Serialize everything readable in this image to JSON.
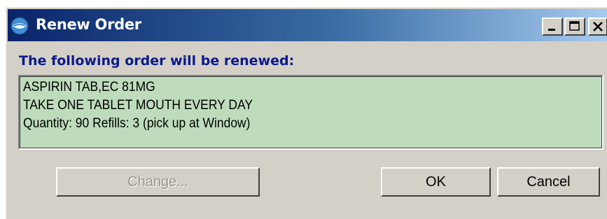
{
  "window": {
    "title": "Renew Order",
    "titlebar_gradient": [
      "#0a246a",
      "#a6caf0"
    ],
    "background": "#d4d0c8"
  },
  "titlebar_buttons": {
    "minimize_icon": "minimize-icon",
    "maximize_icon": "maximize-icon",
    "close_icon": "close-icon"
  },
  "heading": "The following order will be renewed:",
  "order": {
    "lines": [
      "ASPIRIN TAB,EC  81MG",
      "TAKE ONE TABLET MOUTH EVERY DAY",
      "Quantity: 90 Refills: 3 (pick up at Window)"
    ],
    "background": "#bedcbc"
  },
  "buttons": {
    "change": {
      "label": "Change...",
      "enabled": false
    },
    "ok": {
      "label": "OK"
    },
    "cancel": {
      "label": "Cancel"
    }
  },
  "colors": {
    "heading": "#0a1a8a",
    "title_text": "#ffffff"
  }
}
